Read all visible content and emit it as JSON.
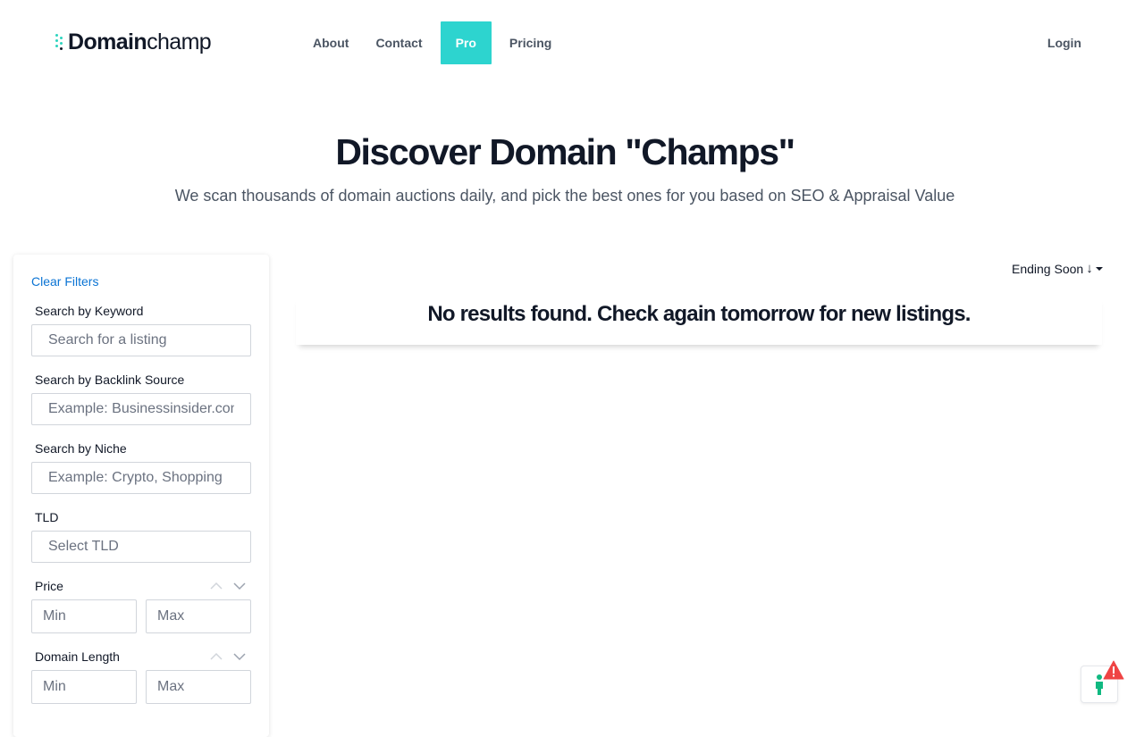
{
  "header": {
    "logo_bold": "Domain",
    "logo_light": "champ",
    "nav": [
      {
        "label": "About"
      },
      {
        "label": "Contact"
      },
      {
        "label": "Pro"
      },
      {
        "label": "Pricing"
      }
    ],
    "login_label": "Login"
  },
  "hero": {
    "title": "Discover Domain \"Champs\"",
    "subtitle": "We scan thousands of domain auctions daily, and pick the best ones for you based on SEO & Appraisal Value"
  },
  "filters": {
    "clear_label": "Clear Filters",
    "keyword": {
      "label": "Search by Keyword",
      "placeholder": "Search for a listing"
    },
    "backlink": {
      "label": "Search by Backlink Source",
      "placeholder": "Example: Businessinsider.com"
    },
    "niche": {
      "label": "Search by Niche",
      "placeholder": "Example: Crypto, Shopping"
    },
    "tld": {
      "label": "TLD",
      "placeholder": "Select TLD"
    },
    "price": {
      "label": "Price",
      "min_placeholder": "Min",
      "max_placeholder": "Max"
    },
    "length": {
      "label": "Domain Length",
      "min_placeholder": "Min",
      "max_placeholder": "Max"
    }
  },
  "results": {
    "sort_label": "Ending Soon",
    "sort_arrow": "↓",
    "empty_message": "No results found. Check again tomorrow for new listings."
  },
  "colors": {
    "accent": "#2dd4cf",
    "link": "#0b74d4",
    "alert": "#ef4444",
    "widget_figure": "#10b981"
  },
  "icons": {
    "sort_direction": "arrow-down-icon",
    "sort_dropdown": "caret-down-icon",
    "sort_up": "chevron-up-icon",
    "sort_down": "chevron-down-icon",
    "widget": "person-icon",
    "alert": "warning-icon"
  }
}
